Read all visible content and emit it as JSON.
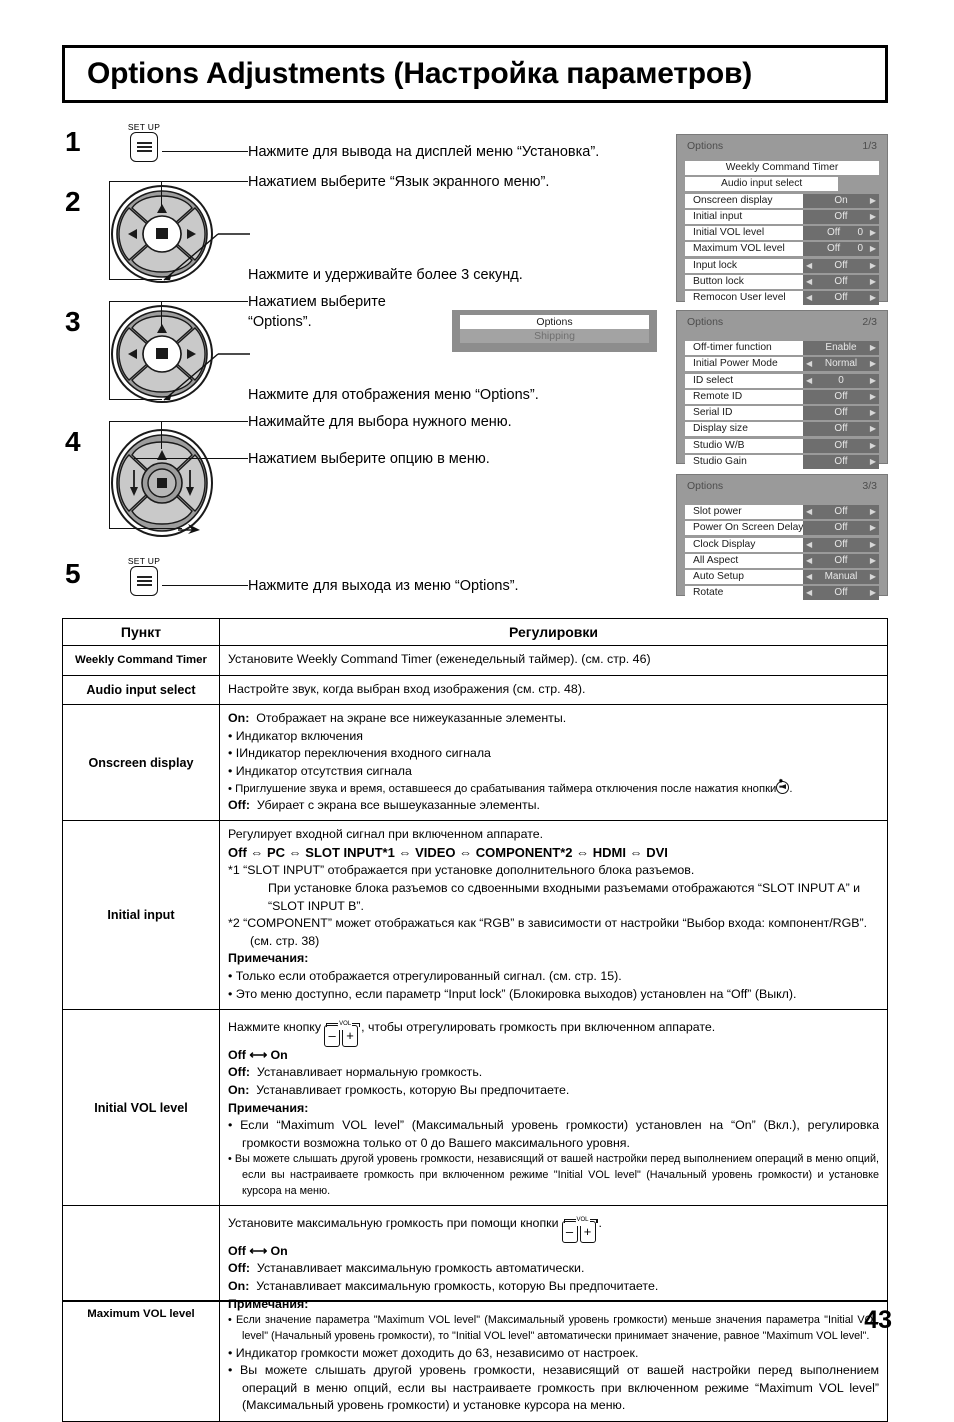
{
  "title": "Options Adjustments (Настройка параметров)",
  "page_number": "43",
  "steps": [
    {
      "num": "1",
      "button_label": "SET UP",
      "instructions": [
        "Нажмите для вывода на дисплей меню “Установка”."
      ]
    },
    {
      "num": "2",
      "instructions": [
        "Нажатием выберите “Язык экранного меню”.",
        "Нажмите и удерживайте более 3 секунд."
      ]
    },
    {
      "num": "3",
      "instructions": [
        "Нажатием выберите",
        "“Options”.",
        "Нажмите для отображения меню “Options”."
      ]
    },
    {
      "num": "4",
      "instructions": [
        "Нажимайте для выбора нужного меню.",
        "Нажатием выберите опцию в меню."
      ]
    },
    {
      "num": "5",
      "button_label": "SET UP",
      "instructions": [
        "Нажмите для выхода из меню “Options”."
      ]
    }
  ],
  "mini_osd": {
    "selected": "Options",
    "unselected": "Shipping"
  },
  "osd_panels": [
    {
      "title": "Options",
      "page": "1/3",
      "rows": [
        {
          "label": "Weekly Command Timer",
          "style": "full"
        },
        {
          "label": "Audio input select",
          "style": "fullshort"
        },
        {
          "label": "Onscreen display",
          "value": "On",
          "arrow_left": false,
          "arrow_right": true
        },
        {
          "label": "Initial input",
          "value": "Off",
          "arrow_left": false,
          "arrow_right": true
        },
        {
          "label": "Initial VOL level",
          "value": "Off",
          "number": "0",
          "arrow_left": false,
          "arrow_right": true
        },
        {
          "label": "Maximum VOL level",
          "value": "Off",
          "number": "0",
          "arrow_left": false,
          "arrow_right": true
        },
        {
          "label": "Input lock",
          "value": "Off",
          "arrow_left": true,
          "arrow_right": true
        },
        {
          "label": "Button lock",
          "value": "Off",
          "arrow_left": true,
          "arrow_right": true
        },
        {
          "label": "Remocon User level",
          "value": "Off",
          "arrow_left": true,
          "arrow_right": true
        }
      ]
    },
    {
      "title": "Options",
      "page": "2/3",
      "rows": [
        {
          "label": "Off-timer function",
          "value": "Enable",
          "arrow_left": false,
          "arrow_right": true
        },
        {
          "label": "Initial Power Mode",
          "value": "Normal",
          "arrow_left": true,
          "arrow_right": true
        },
        {
          "label": "ID select",
          "value": "0",
          "arrow_left": true,
          "arrow_right": true
        },
        {
          "label": "Remote ID",
          "value": "Off",
          "arrow_left": false,
          "arrow_right": true
        },
        {
          "label": "Serial ID",
          "value": "Off",
          "arrow_left": false,
          "arrow_right": true
        },
        {
          "label": "Display size",
          "value": "Off",
          "arrow_left": false,
          "arrow_right": true
        },
        {
          "label": "Studio W/B",
          "value": "Off",
          "arrow_left": false,
          "arrow_right": true
        },
        {
          "label": "Studio Gain",
          "value": "Off",
          "arrow_left": false,
          "arrow_right": true
        }
      ]
    },
    {
      "title": "Options",
      "page": "3/3",
      "rows": [
        {
          "label": "Slot power",
          "value": "Off",
          "arrow_left": true,
          "arrow_right": true
        },
        {
          "label": "Power On Screen Delay",
          "value": "Off",
          "arrow_left": false,
          "arrow_right": true
        },
        {
          "label": "Clock Display",
          "value": "Off",
          "arrow_left": true,
          "arrow_right": true
        },
        {
          "label": "All Aspect",
          "value": "Off",
          "arrow_left": true,
          "arrow_right": true
        },
        {
          "label": "Auto Setup",
          "value": "Manual",
          "arrow_left": true,
          "arrow_right": true
        },
        {
          "label": "Rotate",
          "value": "Off",
          "arrow_left": true,
          "arrow_right": true
        }
      ]
    }
  ],
  "table": {
    "headers": {
      "item": "Пункт",
      "adjust": "Регулировки"
    },
    "rows": {
      "weekly": {
        "item": "Weekly Command Timer",
        "desc": "Установите Weekly Command Timer (еженедельный таймер). (см. стр. 46)"
      },
      "audio": {
        "item": "Audio input select",
        "desc": "Настройте звук, когда выбран вход изображения (см. стр. 48)."
      },
      "onscreen": {
        "item": "Onscreen display",
        "on_label": "On:",
        "on_text": "Отображает на экране все нижеуказанные элементы.",
        "bullets": [
          "• Индикатор включения",
          "• IИндикатор переключения входного сигнала",
          "• Индикатор отсутствия сигнала"
        ],
        "bullet_mute_pre": "• Приглушение звука и время, оставшееся до срабатывания таймера отключения после нажатия кнопки",
        "bullet_mute_post": ".",
        "off_label": "Off:",
        "off_text": "Убирает с экрана все вышеуказанные элементы."
      },
      "initial_input": {
        "item": "Initial input",
        "line1": "Регулирует входной сигнал при включенном аппарате.",
        "chain": "Off ⇔ PC ⇔ SLOT INPUT*1 ⇔ VIDEO ⇔ COMPONENT*2 ⇔ HDMI ⇔ DVI",
        "note1": "*1  “SLOT INPUT” отображается при установке дополнительного блока разъемов.",
        "note1b": "При установке блока разъемов со сдвоенными входными разъемами отображаются “SLOT INPUT A” и “SLOT INPUT B”.",
        "note2": "*2  “COMPONENT” может отображаться как “RGB” в зависимости от настройки “Выбор входа: компонент/RGB”. (см. стр. 38)",
        "notes_label": "Примечания:",
        "notes": [
          "• Только если отображается отрегулированный сигнал. (см. стр. 15).",
          "• Это меню доступно, если параметр “Input lock” (Блокировка выходов) установлен на “Off” (Выкл)."
        ]
      },
      "initial_vol": {
        "item": "Initial VOL level",
        "line1_pre": "Нажмите кнопку",
        "line1_post": ", чтобы отрегулировать громкость при включенном аппарате.",
        "toggle": "Off ⟷ On",
        "off_label": "Off:",
        "off_text": "Устанавливает нормальную громкость.",
        "on_label": "On:",
        "on_text": "Устанавливает громкость, которую Вы предпочитаете.",
        "notes_label": "Примечания:",
        "note1": "• Если “Maximum VOL level” (Максимальный уровень громкости) установлен на “On” (Вкл.), регулировка громкости возможна только от 0 до Вашего максимального уровня.",
        "note2": "• Вы можете слышать другой уровень громкости, независящий от вашей настройки перед выполнением операций в меню опций, если вы настраиваете громкость при включенном режиме \"Initial VOL level\" (Начальный уровень громкости) и установке курсора на меню."
      },
      "maximum_vol": {
        "item": "Maximum VOL level",
        "line1_pre": "Установите максимальную громкость при помощи кнопки",
        "line1_post": ".",
        "toggle": "Off ⟷ On",
        "off_label": "Off:",
        "off_text": "Устанавливает максимальную громкость автоматически.",
        "on_label": "On:",
        "on_text": "Устанавливает максимальную громкость, которую Вы предпочитаете.",
        "notes_label": "Примечания:",
        "note1": "• Если значение параметра \"Maximum VOL level\" (Максимальный уровень громкости) меньше значения параметра \"Initial VOL level\" (Начальный уровень громкости), то \"Initial VOL level\" автоматически принимает значение, равное \"Maximum VOL level\".",
        "note2": "• Индикатор громкости может доходить до 63, независимо от настроек.",
        "note3": "• Вы можете слышать другой уровень громкости, независящий от вашей настройки перед выполнением операций в меню опций, если вы настраиваете громкость при включенном режиме “Maximum VOL level” (Максимальный уровень громкости) и установке курсора на меню."
      }
    }
  },
  "vol_button": {
    "cap_label": "VOL",
    "minus": "–",
    "plus": "+"
  }
}
